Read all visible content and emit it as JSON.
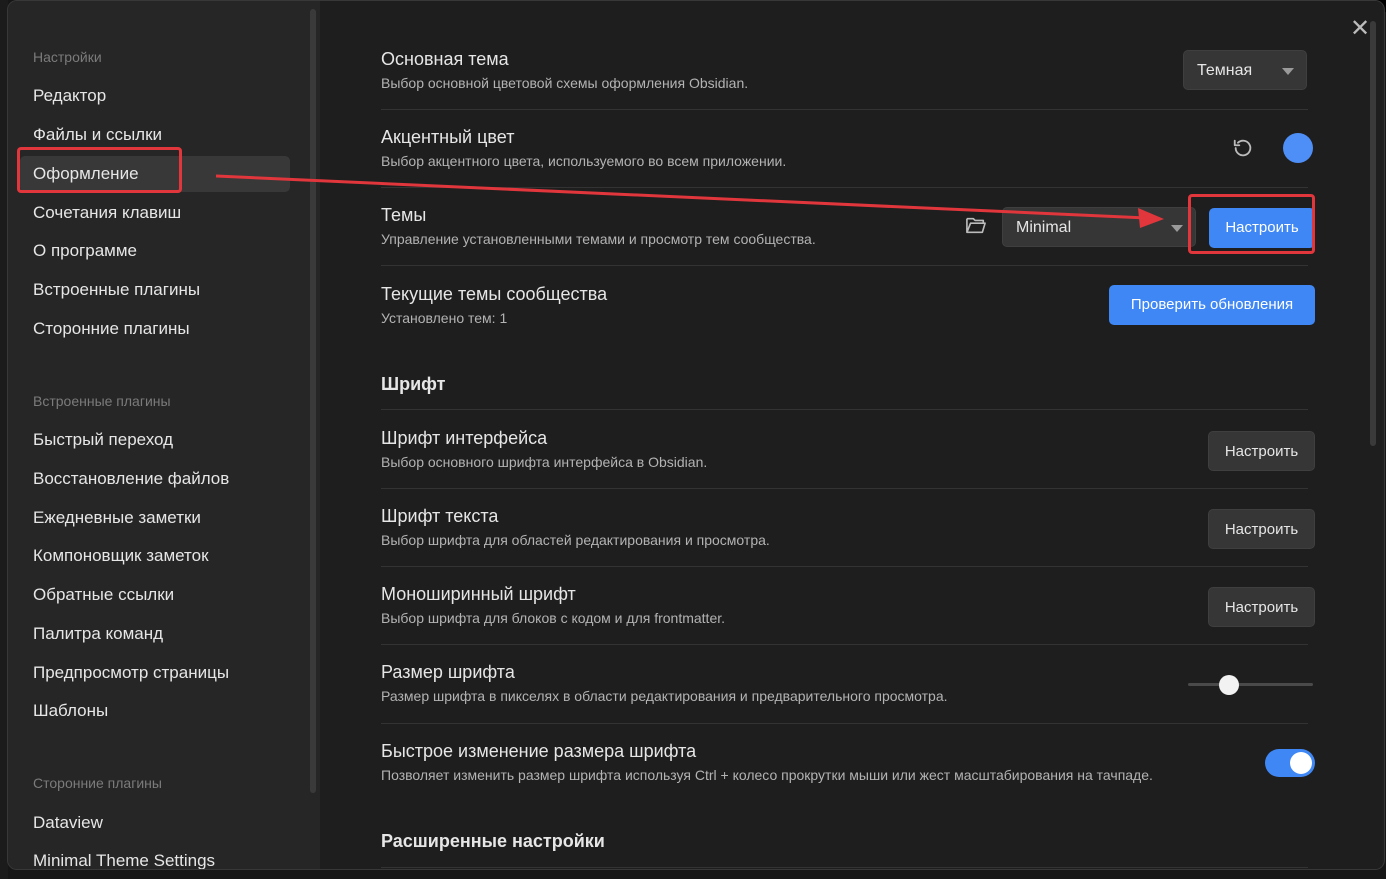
{
  "sidebar": {
    "group1_title": "Настройки",
    "group1_items": [
      {
        "label": "Редактор"
      },
      {
        "label": "Файлы и ссылки"
      },
      {
        "label": "Оформление"
      },
      {
        "label": "Сочетания клавиш"
      },
      {
        "label": "О программе"
      },
      {
        "label": "Встроенные плагины"
      },
      {
        "label": "Сторонние плагины"
      }
    ],
    "group2_title": "Встроенные плагины",
    "group2_items": [
      {
        "label": "Быстрый переход"
      },
      {
        "label": "Восстановление файлов"
      },
      {
        "label": "Ежедневные заметки"
      },
      {
        "label": "Компоновщик заметок"
      },
      {
        "label": "Обратные ссылки"
      },
      {
        "label": "Палитра команд"
      },
      {
        "label": "Предпросмотр страницы"
      },
      {
        "label": "Шаблоны"
      }
    ],
    "group3_title": "Сторонние плагины",
    "group3_items": [
      {
        "label": "Dataview"
      },
      {
        "label": "Minimal Theme Settings"
      }
    ]
  },
  "content": {
    "base_theme": {
      "name": "Основная тема",
      "desc": "Выбор основной цветовой схемы оформления Obsidian.",
      "value": "Темная"
    },
    "accent_color": {
      "name": "Акцентный цвет",
      "desc": "Выбор акцентного цвета, используемого во всем приложении.",
      "color": "#4e8ef7"
    },
    "themes": {
      "name": "Темы",
      "desc": "Управление установленными темами и просмотр тем сообщества.",
      "value": "Minimal",
      "button": "Настроить"
    },
    "community_themes": {
      "name": "Текущие темы сообщества",
      "desc": "Установлено тем: 1",
      "button": "Проверить обновления"
    },
    "font_heading": "Шрифт",
    "interface_font": {
      "name": "Шрифт интерфейса",
      "desc": "Выбор основного шрифта интерфейса в Obsidian.",
      "button": "Настроить"
    },
    "text_font": {
      "name": "Шрифт текста",
      "desc": "Выбор шрифта для областей редактирования и просмотра.",
      "button": "Настроить"
    },
    "mono_font": {
      "name": "Моноширинный шрифт",
      "desc": "Выбор шрифта для блоков с кодом и для frontmatter.",
      "button": "Настроить"
    },
    "font_size": {
      "name": "Размер шрифта",
      "desc": "Размер шрифта в пикселях в области редактирования и предварительного просмотра.",
      "slider_fraction": 0.33
    },
    "quick_font_size": {
      "name": "Быстрое изменение размера шрифта",
      "desc": "Позволяет изменить размер шрифта используя Ctrl + колесо прокрутки мыши или жест масштабирования на тачпаде.",
      "enabled": true
    },
    "advanced_heading": "Расширенные настройки"
  },
  "colors": {
    "accent": "#3f87f5",
    "highlight": "#e0363c"
  }
}
